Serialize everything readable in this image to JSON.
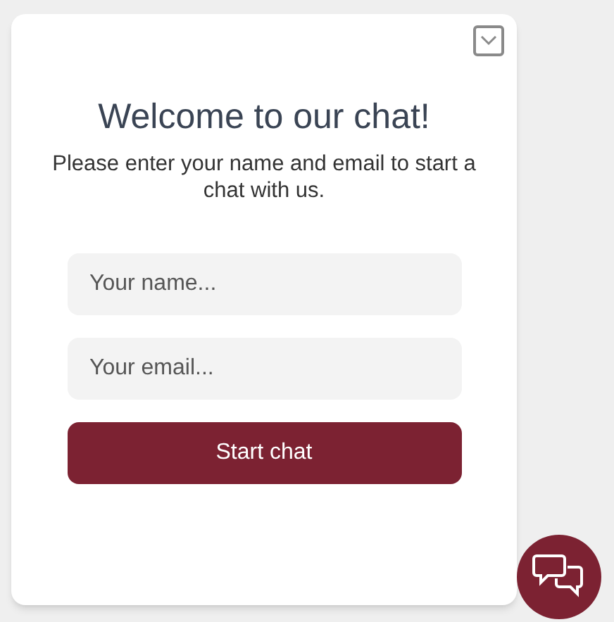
{
  "title": "Welcome to our chat!",
  "subtitle": "Please enter your name and email to start a chat with us.",
  "fields": [
    {
      "placeholder": "Your name..."
    },
    {
      "placeholder": "Your email..."
    }
  ],
  "button": "Start chat"
}
